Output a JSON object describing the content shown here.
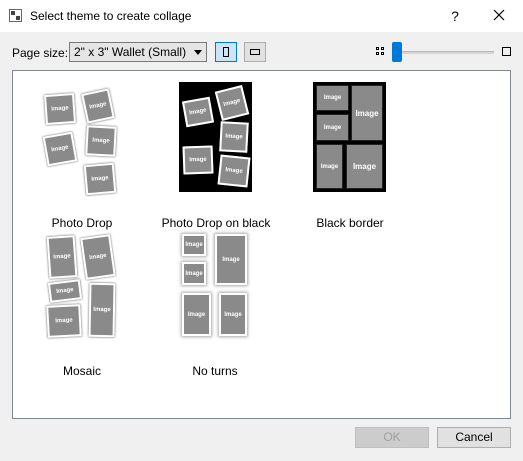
{
  "window": {
    "title": "Select theme to create collage",
    "help_label": "?"
  },
  "toolbar": {
    "page_size_label": "Page size:",
    "page_size_value": "2\" x 3\" Wallet (Small)",
    "orientation": "portrait"
  },
  "themes": [
    {
      "label": "Photo Drop",
      "image_text": "Image"
    },
    {
      "label": "Photo Drop on black",
      "image_text": "Image"
    },
    {
      "label": "Black border",
      "image_text": "Image"
    },
    {
      "label": "Mosaic",
      "image_text": "Image"
    },
    {
      "label": "No turns",
      "image_text": "Image"
    }
  ],
  "buttons": {
    "ok": "OK",
    "cancel": "Cancel"
  }
}
